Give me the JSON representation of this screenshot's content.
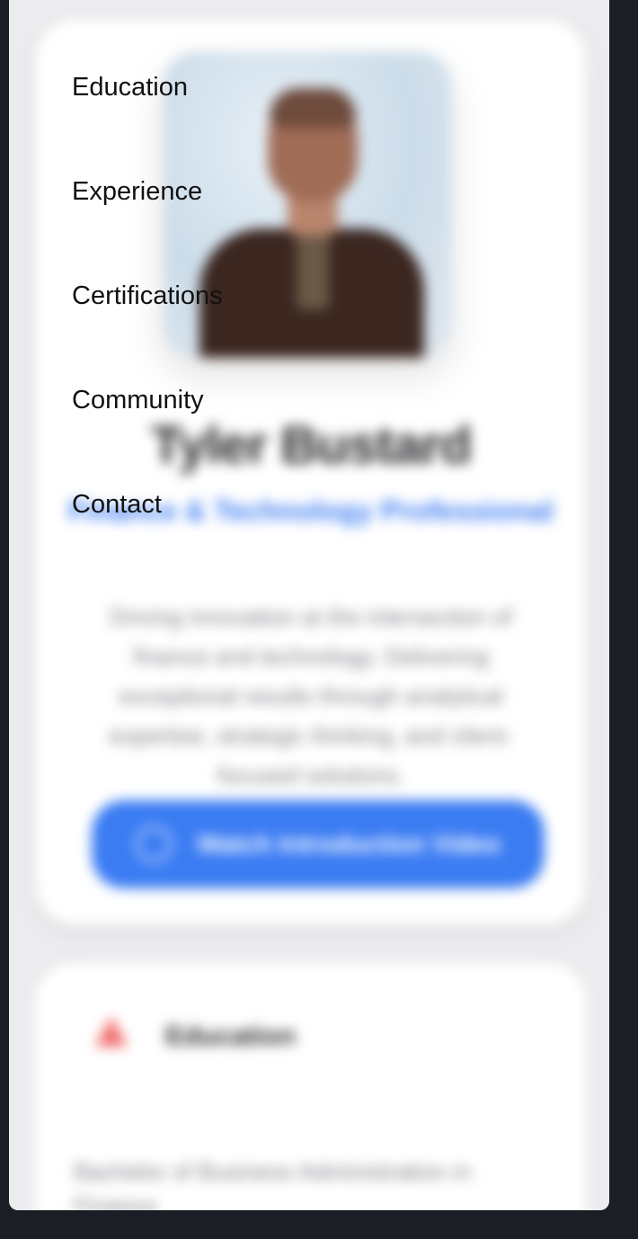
{
  "nav": {
    "items": [
      {
        "label": "Education"
      },
      {
        "label": "Experience"
      },
      {
        "label": "Certifications"
      },
      {
        "label": "Community"
      },
      {
        "label": "Contact"
      }
    ]
  },
  "hero": {
    "name": "Tyler Bustard",
    "role": "Finance & Technology Professional",
    "bio": "Driving innovation at the intersection of finance and technology. Delivering exceptional results through analytical expertise, strategic thinking, and client-focused solutions.",
    "video_button_label": "Watch Introduction Video"
  },
  "education": {
    "heading": "Education",
    "degree": "Bachelor of Business Administration in Finance"
  },
  "colors": {
    "accent": "#3b7cf3",
    "education_icon": "#f26d6d",
    "frame": "#1b1f25",
    "page_background": "#ececef"
  }
}
